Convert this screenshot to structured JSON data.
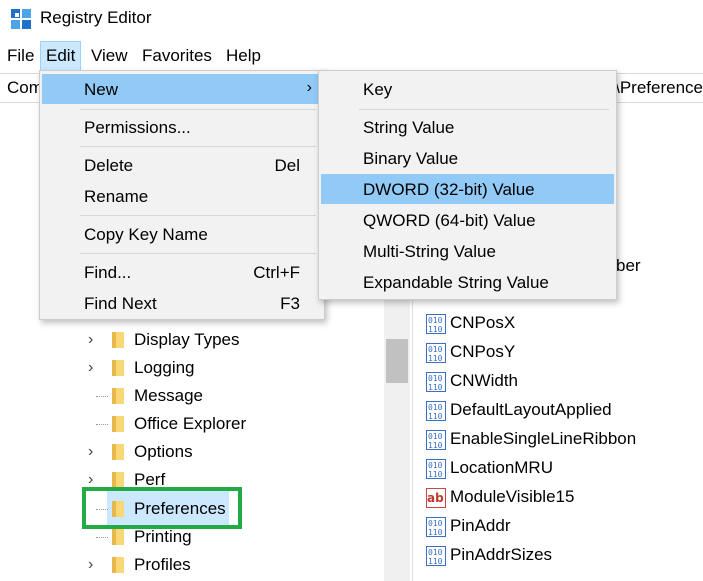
{
  "window": {
    "title": "Registry Editor"
  },
  "menubar": {
    "items": [
      "File",
      "Edit",
      "View",
      "Favorites",
      "Help"
    ],
    "active": "Edit"
  },
  "address": {
    "left_text": "Com",
    "right_text": "\\Preference"
  },
  "tree": {
    "items": [
      {
        "label": "Display Types",
        "expandable": true
      },
      {
        "label": "Logging",
        "expandable": true
      },
      {
        "label": "Message",
        "expandable": false
      },
      {
        "label": "Office Explorer",
        "expandable": false
      },
      {
        "label": "Options",
        "expandable": true
      },
      {
        "label": "Perf",
        "expandable": true
      },
      {
        "label": "Preferences",
        "expandable": false,
        "selected": true
      },
      {
        "label": "Printing",
        "expandable": false
      },
      {
        "label": "Profiles",
        "expandable": true
      }
    ]
  },
  "values": {
    "partial_top": "ber",
    "items": [
      {
        "label": "CNPosX",
        "type": "binary"
      },
      {
        "label": "CNPosY",
        "type": "binary"
      },
      {
        "label": "CNWidth",
        "type": "binary"
      },
      {
        "label": "DefaultLayoutApplied",
        "type": "binary"
      },
      {
        "label": "EnableSingleLineRibbon",
        "type": "binary"
      },
      {
        "label": "LocationMRU",
        "type": "binary"
      },
      {
        "label": "ModuleVisible15",
        "type": "string"
      },
      {
        "label": "PinAddr",
        "type": "binary"
      },
      {
        "label": "PinAddrSizes",
        "type": "binary"
      }
    ]
  },
  "edit_menu": {
    "new": "New",
    "permissions": "Permissions...",
    "delete": "Delete",
    "delete_key": "Del",
    "rename": "Rename",
    "copy_key_name": "Copy Key Name",
    "find": "Find...",
    "find_key": "Ctrl+F",
    "find_next": "Find Next",
    "find_next_key": "F3"
  },
  "new_submenu": {
    "key": "Key",
    "string": "String Value",
    "binary": "Binary Value",
    "dword": "DWORD (32-bit) Value",
    "qword": "QWORD (64-bit) Value",
    "multi": "Multi-String Value",
    "expandable": "Expandable String Value"
  },
  "colors": {
    "menu_hover": "#91c9f7",
    "highlight_box": "#22aa44",
    "selection": "#cce8ff"
  }
}
